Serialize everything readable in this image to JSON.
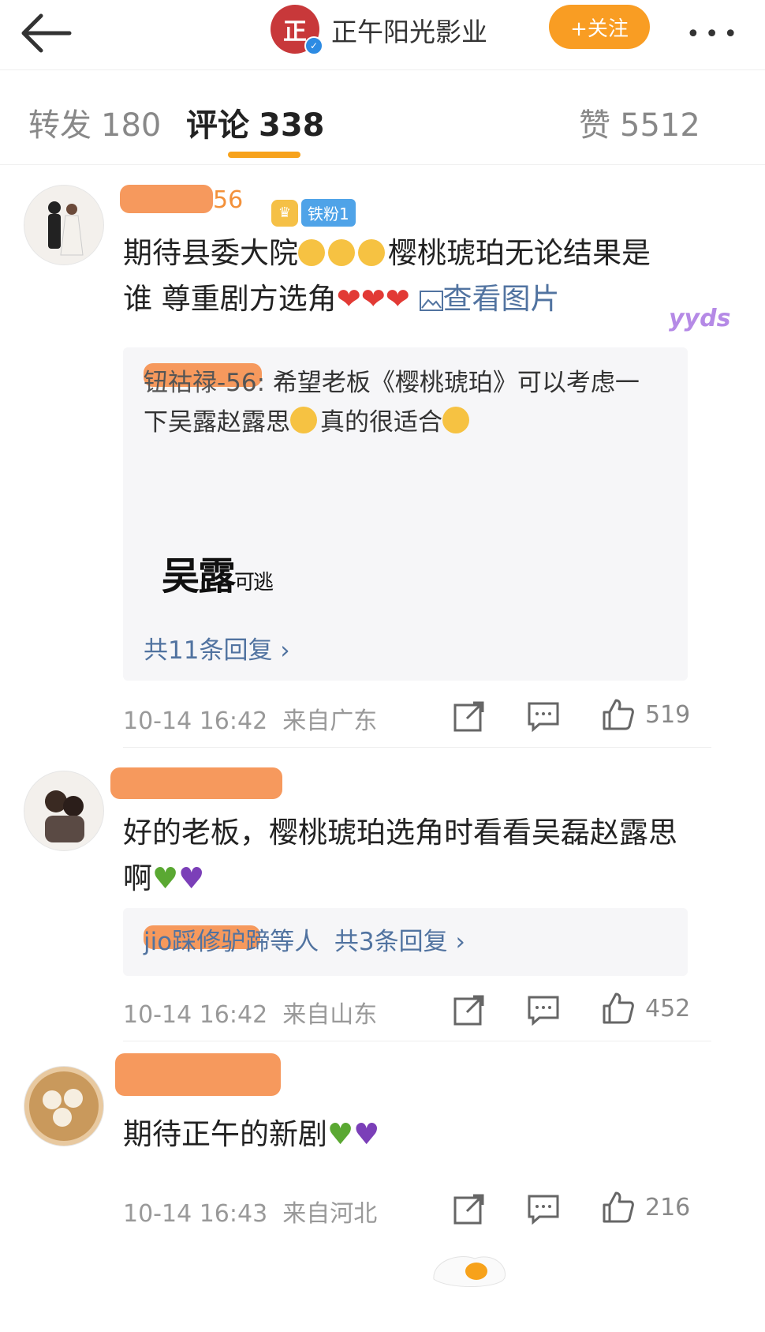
{
  "header": {
    "account_name": "正午阳光影业",
    "logo_text": "正",
    "follow_label": "+关注",
    "more_label": "•••"
  },
  "tabs": [
    {
      "label": "转发",
      "count": "180"
    },
    {
      "label": "评论",
      "count": "338"
    },
    {
      "label": "赞",
      "count": "5512"
    }
  ],
  "comments": [
    {
      "user_suffix": "56",
      "fan_badge": "铁粉1",
      "text_a": "期待县委大院",
      "text_b": "樱桃琥珀无论结果是",
      "text_c": "谁 尊重剧方选角",
      "hearts": "❤❤❤",
      "view_image": "查看图片",
      "reply_prefix": "钮祜禄-56:",
      "reply_text_a": "希望老板《樱桃琥珀》可以考虑一",
      "reply_text_b": "下吴露赵露思",
      "reply_text_c": "真的很适合",
      "sticker_main": "吴露",
      "sticker_sub": "可逃",
      "reply_count": "共11条回复 ›",
      "time": "10-14 16:42",
      "location": "来自广东",
      "likes": "519"
    },
    {
      "text_a": "好的老板，樱桃琥珀选角时看看吴磊赵露思",
      "text_b": "啊",
      "reply_users": "jio踩修驴蹄等人",
      "reply_count": "共3条回复 ›",
      "time": "10-14 16:42",
      "location": "来自山东",
      "likes": "452"
    },
    {
      "text_a": "期待正午的新剧",
      "time": "10-14 16:43",
      "location": "来自河北",
      "likes": "216"
    }
  ],
  "decorations": {
    "yyds": "yyds"
  }
}
